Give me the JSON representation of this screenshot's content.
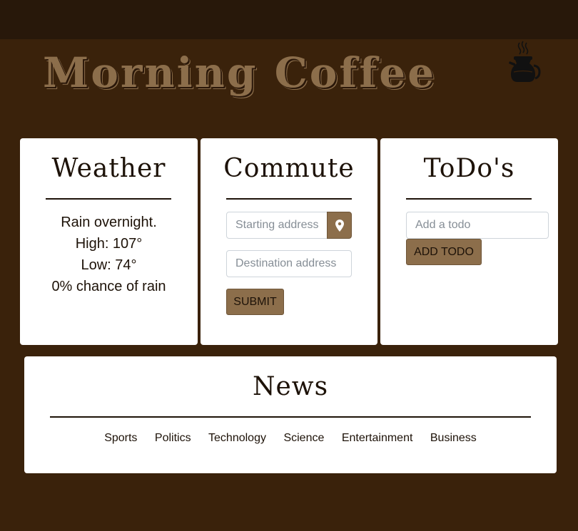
{
  "header": {
    "title": "Morning Coffee",
    "icon": "coffee-pot-icon"
  },
  "weather": {
    "title": "Weather",
    "summary": "Rain overnight.",
    "high": "High: 107°",
    "low": "Low: 74°",
    "precip": "0% chance of rain"
  },
  "commute": {
    "title": "Commute",
    "start_placeholder": "Starting address",
    "start_value": "",
    "location_icon": "map-marker-icon",
    "destination_placeholder": "Destination address",
    "destination_value": "",
    "submit_label": "SUBMIT"
  },
  "todos": {
    "title": "ToDo's",
    "input_placeholder": "Add a todo",
    "input_value": "",
    "add_label": "ADD TODO"
  },
  "news": {
    "title": "News",
    "tabs": [
      "Sports",
      "Politics",
      "Technology",
      "Science",
      "Entertainment",
      "Business"
    ]
  },
  "colors": {
    "background": "#3a220b",
    "topbar": "#28180a",
    "accent": "#8c6e4b",
    "card": "#ffffff",
    "text": "#1d1208"
  }
}
